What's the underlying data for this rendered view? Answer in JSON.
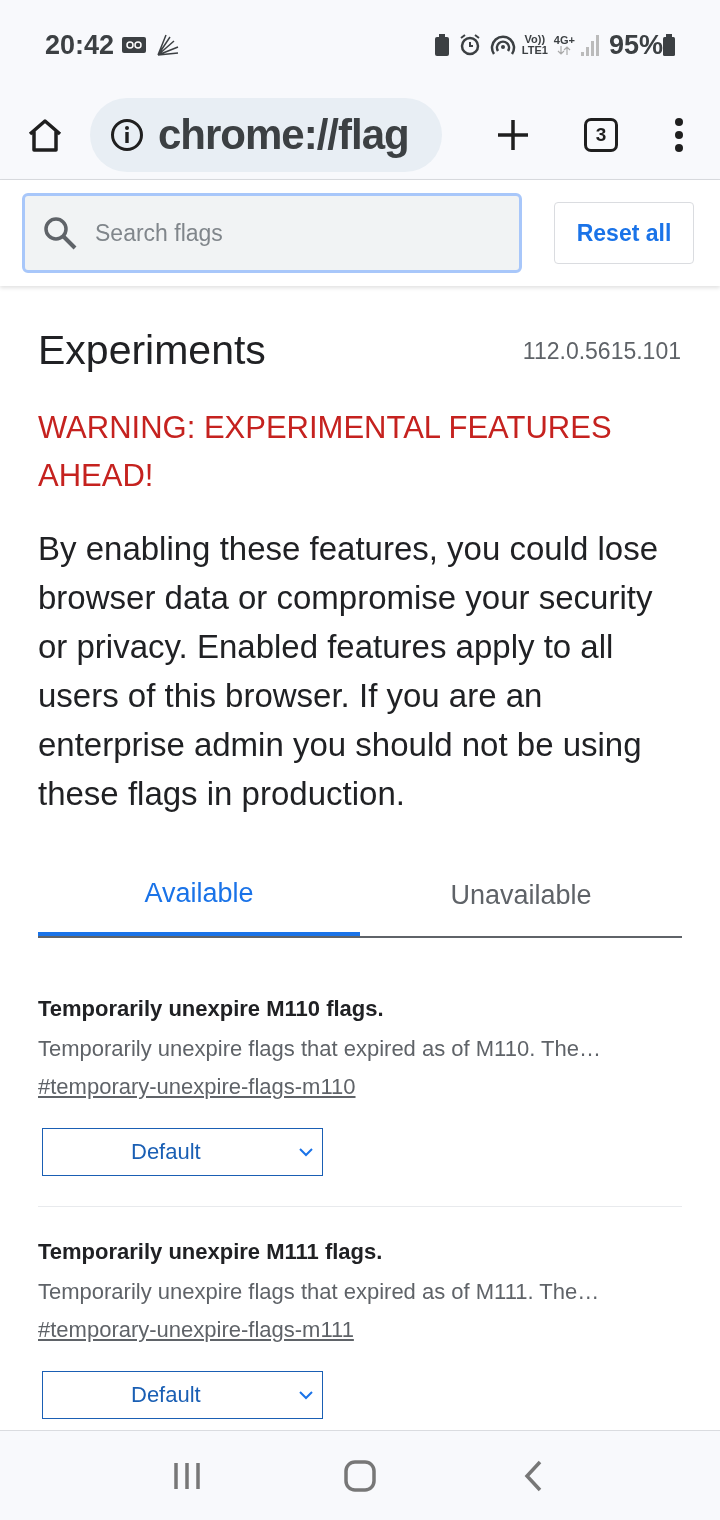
{
  "status_bar": {
    "time": "20:42",
    "volte": "Vo))",
    "lte": "LTE1",
    "network": "4G+",
    "battery": "95%"
  },
  "toolbar": {
    "url": "chrome://flag",
    "tab_count": "3"
  },
  "search": {
    "placeholder": "Search flags"
  },
  "reset_button": "Reset all",
  "header": {
    "title": "Experiments",
    "version": "112.0.5615.101"
  },
  "warning": "WARNING: EXPERIMENTAL FEATURES AHEAD!",
  "description": "By enabling these features, you could lose browser data or compromise your security or privacy. Enabled features apply to all users of this browser. If you are an enterprise admin you should not be using these flags in production.",
  "tabs": [
    {
      "label": "Available",
      "selected": true
    },
    {
      "label": "Unavailable",
      "selected": false
    }
  ],
  "flags": [
    {
      "title": "Temporarily unexpire M110 flags.",
      "description": "Temporarily unexpire flags that expired as of M110. The…",
      "link": "#temporary-unexpire-flags-m110",
      "value": "Default"
    },
    {
      "title": "Temporarily unexpire M111 flags.",
      "description": "Temporarily unexpire flags that expired as of M111. The…",
      "link": "#temporary-unexpire-flags-m111",
      "value": "Default"
    }
  ]
}
